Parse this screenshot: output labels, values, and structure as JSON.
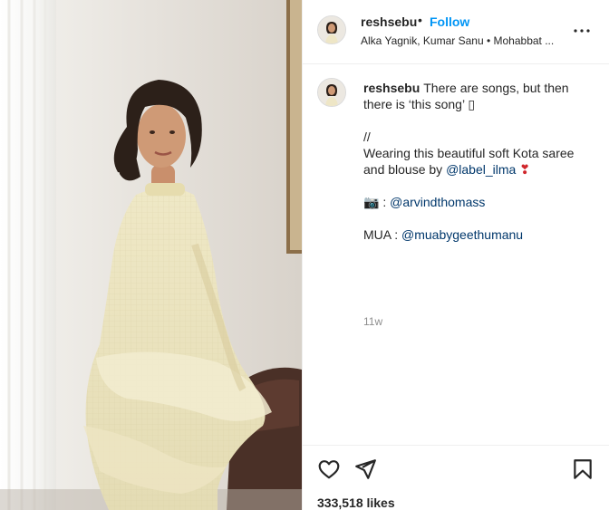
{
  "post": {
    "username": "reshsebu",
    "follow_label": "Follow",
    "separator": "•",
    "audio": "Alka Yagnik, Kumar Sanu • Mohabbat ..."
  },
  "caption": {
    "username": "reshsebu",
    "line1": "There are songs, but then there is ‘this song’ ▯",
    "line2": "//",
    "line3_text": "Wearing this beautiful soft Kota saree and blouse by ",
    "line3_mention": "@label_ilma",
    "line3_emoji": "❣",
    "camera_emoji": "📷",
    "credit_sep": " : ",
    "photographer": "@arvindthomass",
    "mua_label": "MUA : ",
    "mua": "@muabygeethumanu",
    "time": "11w"
  },
  "engagement": {
    "likes": "333,518 likes"
  },
  "icons": {
    "more": "more-options-icon",
    "like": "heart-icon",
    "share": "share-icon",
    "save": "bookmark-icon"
  },
  "colors": {
    "follow": "#0095f6",
    "mention": "#00376b",
    "muted": "#8e8e8e",
    "divider": "#efefef"
  }
}
